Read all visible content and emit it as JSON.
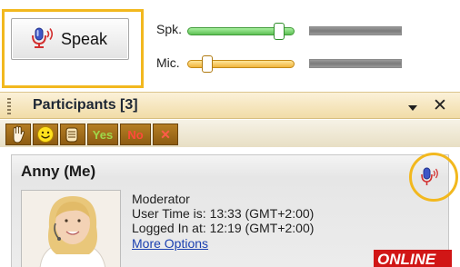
{
  "audio": {
    "speak_label": "Speak",
    "speaker_label": "Spk.",
    "mic_label": "Mic.",
    "speaker_level": 0.9,
    "mic_level": 0.15
  },
  "panel": {
    "title": "Participants [3]",
    "menu_icon": "dropdown-arrow",
    "close_label": "✕"
  },
  "toolbar": {
    "buttons": [
      {
        "icon": "raise-hand-icon"
      },
      {
        "icon": "smiley-icon"
      },
      {
        "icon": "applause-icon"
      },
      {
        "label": "Yes"
      },
      {
        "label": "No"
      },
      {
        "label": "✕"
      }
    ]
  },
  "participants": [
    {
      "name": "Anny (Me)",
      "role": "Moderator",
      "user_time": "User Time is: 13:33 (GMT+2:00)",
      "logged_in": "Logged In at: 12:19 (GMT+2:00)",
      "more_options": "More Options",
      "status": "ONLINE"
    }
  ],
  "colors": {
    "highlight": "#f2b81e",
    "speaker_slider": "#6fce66",
    "mic_slider": "#f3c35a",
    "online_badge": "#d11616",
    "toolbar_button": "#a16d1a"
  }
}
